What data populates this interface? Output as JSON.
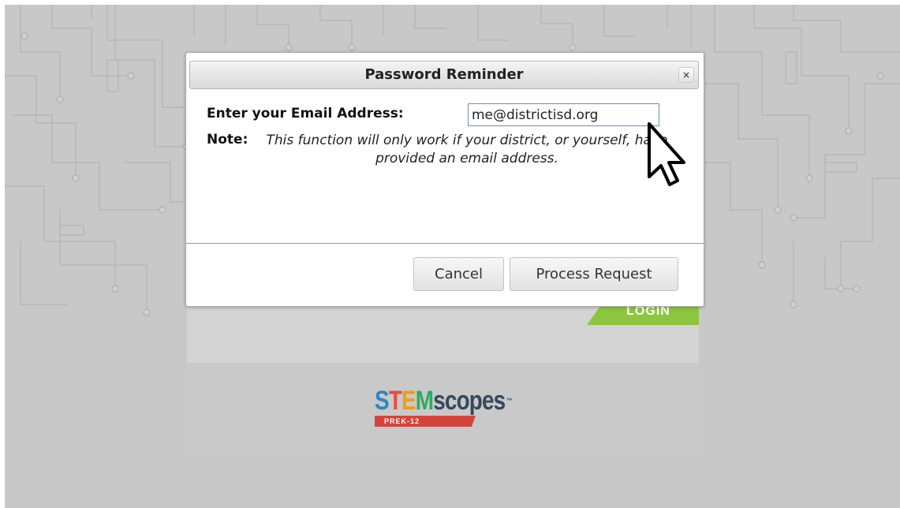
{
  "dialog": {
    "title": "Password Reminder",
    "close_symbol": "×",
    "email_label": "Enter your Email Address:",
    "email_value": "me@districtisd.org",
    "note_label": "Note:",
    "note_text": "This function will only work if your district, or yourself, have provided an email address.",
    "cancel_label": "Cancel",
    "process_label": "Process Request"
  },
  "login": {
    "tab_label": "LOGIN"
  },
  "logo": {
    "letter_s": "S",
    "letter_t": "T",
    "letter_e": "E",
    "letter_m": "M",
    "word_rest": "scopes",
    "trademark": "™",
    "tagline": "PREK-12"
  },
  "icons": {
    "close": "close-icon",
    "cursor": "mouse-pointer-icon",
    "background": "circuit-pattern"
  },
  "colors": {
    "login_green": "#8cc63f",
    "logo_red": "#d6433a",
    "input_border": "#6b8fb5",
    "page_background": "#c8c8c8"
  }
}
